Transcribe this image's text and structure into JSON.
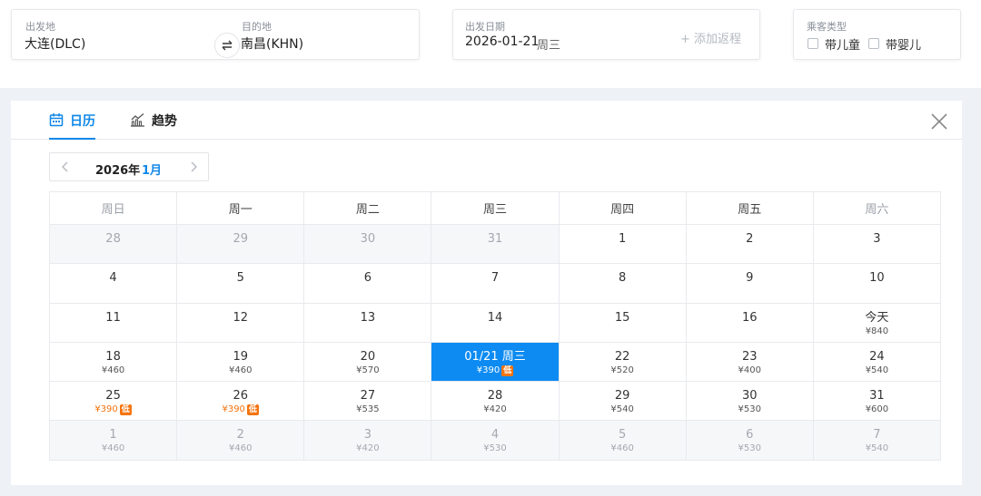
{
  "search": {
    "origin_label": "出发地",
    "origin_value": "大连(DLC)",
    "dest_label": "目的地",
    "dest_value": "南昌(KHN)",
    "date_label": "出发日期",
    "date_value": "2026-01-21",
    "date_weekday": "周三",
    "add_return": "+ 添加返程",
    "passenger_label": "乘客类型",
    "child_label": "带儿童",
    "infant_label": "带婴儿"
  },
  "tabs": [
    {
      "label": "日历",
      "icon": "calendar-icon",
      "active": true
    },
    {
      "label": "趋势",
      "icon": "trend-chart-icon",
      "active": false
    }
  ],
  "month_nav": {
    "year": "2026年",
    "month": "1月"
  },
  "weekdays": [
    "周日",
    "周一",
    "周二",
    "周三",
    "周四",
    "周五",
    "周六"
  ],
  "weeks": [
    [
      {
        "day": "28",
        "muted": true
      },
      {
        "day": "29",
        "muted": true
      },
      {
        "day": "30",
        "muted": true
      },
      {
        "day": "31",
        "muted": true
      },
      {
        "day": "1"
      },
      {
        "day": "2"
      },
      {
        "day": "3"
      }
    ],
    [
      {
        "day": "4"
      },
      {
        "day": "5"
      },
      {
        "day": "6"
      },
      {
        "day": "7"
      },
      {
        "day": "8"
      },
      {
        "day": "9"
      },
      {
        "day": "10"
      }
    ],
    [
      {
        "day": "11"
      },
      {
        "day": "12"
      },
      {
        "day": "13"
      },
      {
        "day": "14"
      },
      {
        "day": "15"
      },
      {
        "day": "16"
      },
      {
        "day": "今天",
        "price": "¥840"
      }
    ],
    [
      {
        "day": "18",
        "price": "¥460"
      },
      {
        "day": "19",
        "price": "¥460"
      },
      {
        "day": "20",
        "price": "¥570"
      },
      {
        "day": "01/21 周三",
        "price": "¥390",
        "low": true,
        "selected": true
      },
      {
        "day": "22",
        "price": "¥520"
      },
      {
        "day": "23",
        "price": "¥400"
      },
      {
        "day": "24",
        "price": "¥540"
      }
    ],
    [
      {
        "day": "25",
        "price": "¥390",
        "low": true
      },
      {
        "day": "26",
        "price": "¥390",
        "low": true
      },
      {
        "day": "27",
        "price": "¥535"
      },
      {
        "day": "28",
        "price": "¥420"
      },
      {
        "day": "29",
        "price": "¥540"
      },
      {
        "day": "30",
        "price": "¥530"
      },
      {
        "day": "31",
        "price": "¥600"
      }
    ],
    [
      {
        "day": "1",
        "price": "¥460",
        "muted": true
      },
      {
        "day": "2",
        "price": "¥460",
        "muted": true
      },
      {
        "day": "3",
        "price": "¥420",
        "muted": true
      },
      {
        "day": "4",
        "price": "¥530",
        "muted": true
      },
      {
        "day": "5",
        "price": "¥460",
        "muted": true
      },
      {
        "day": "6",
        "price": "¥530",
        "muted": true
      },
      {
        "day": "7",
        "price": "¥540",
        "muted": true
      }
    ]
  ],
  "low_badge_text": "低",
  "colors": {
    "accent": "#0f87e8",
    "selected": "#0d8bf2",
    "low": "#f5740f"
  }
}
